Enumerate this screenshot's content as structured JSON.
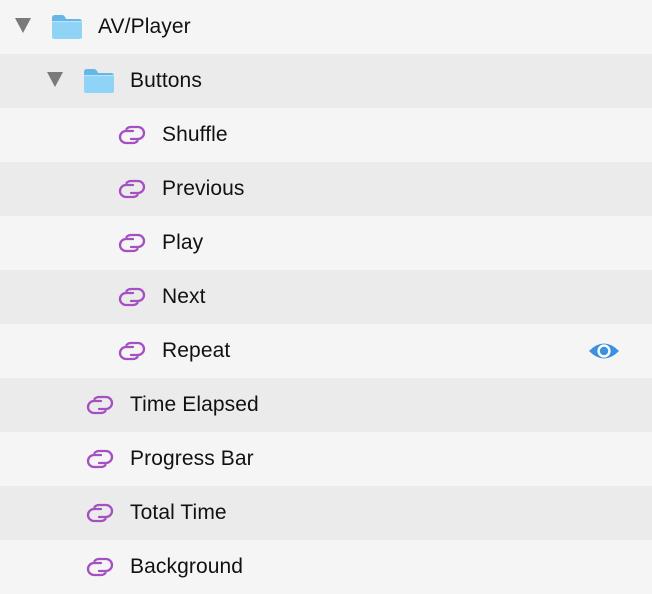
{
  "layers": {
    "group_root": {
      "label": "AV/Player",
      "expanded": true,
      "icon": "folder-icon"
    },
    "group_buttons": {
      "label": "Buttons",
      "expanded": true,
      "icon": "folder-icon"
    },
    "buttons_children": [
      {
        "label": "Shuffle",
        "icon": "symbol-instance-icon"
      },
      {
        "label": "Previous",
        "icon": "symbol-instance-icon"
      },
      {
        "label": "Play",
        "icon": "symbol-instance-icon"
      },
      {
        "label": "Next",
        "icon": "symbol-instance-icon"
      },
      {
        "label": "Repeat",
        "icon": "symbol-instance-icon",
        "visibility_icon": "eye-icon"
      }
    ],
    "root_children": [
      {
        "label": "Time Elapsed",
        "icon": "symbol-instance-icon"
      },
      {
        "label": "Progress Bar",
        "icon": "symbol-instance-icon"
      },
      {
        "label": "Total Time",
        "icon": "symbol-instance-icon"
      },
      {
        "label": "Background",
        "icon": "symbol-instance-icon"
      }
    ]
  },
  "colors": {
    "folder": "#7cc9f2",
    "symbol": "#a44fc2",
    "eye": "#3b91e0",
    "disclosure": "#7a7a7a",
    "row_light": "#f5f5f5",
    "row_dark": "#ebebeb",
    "text": "#111111"
  }
}
